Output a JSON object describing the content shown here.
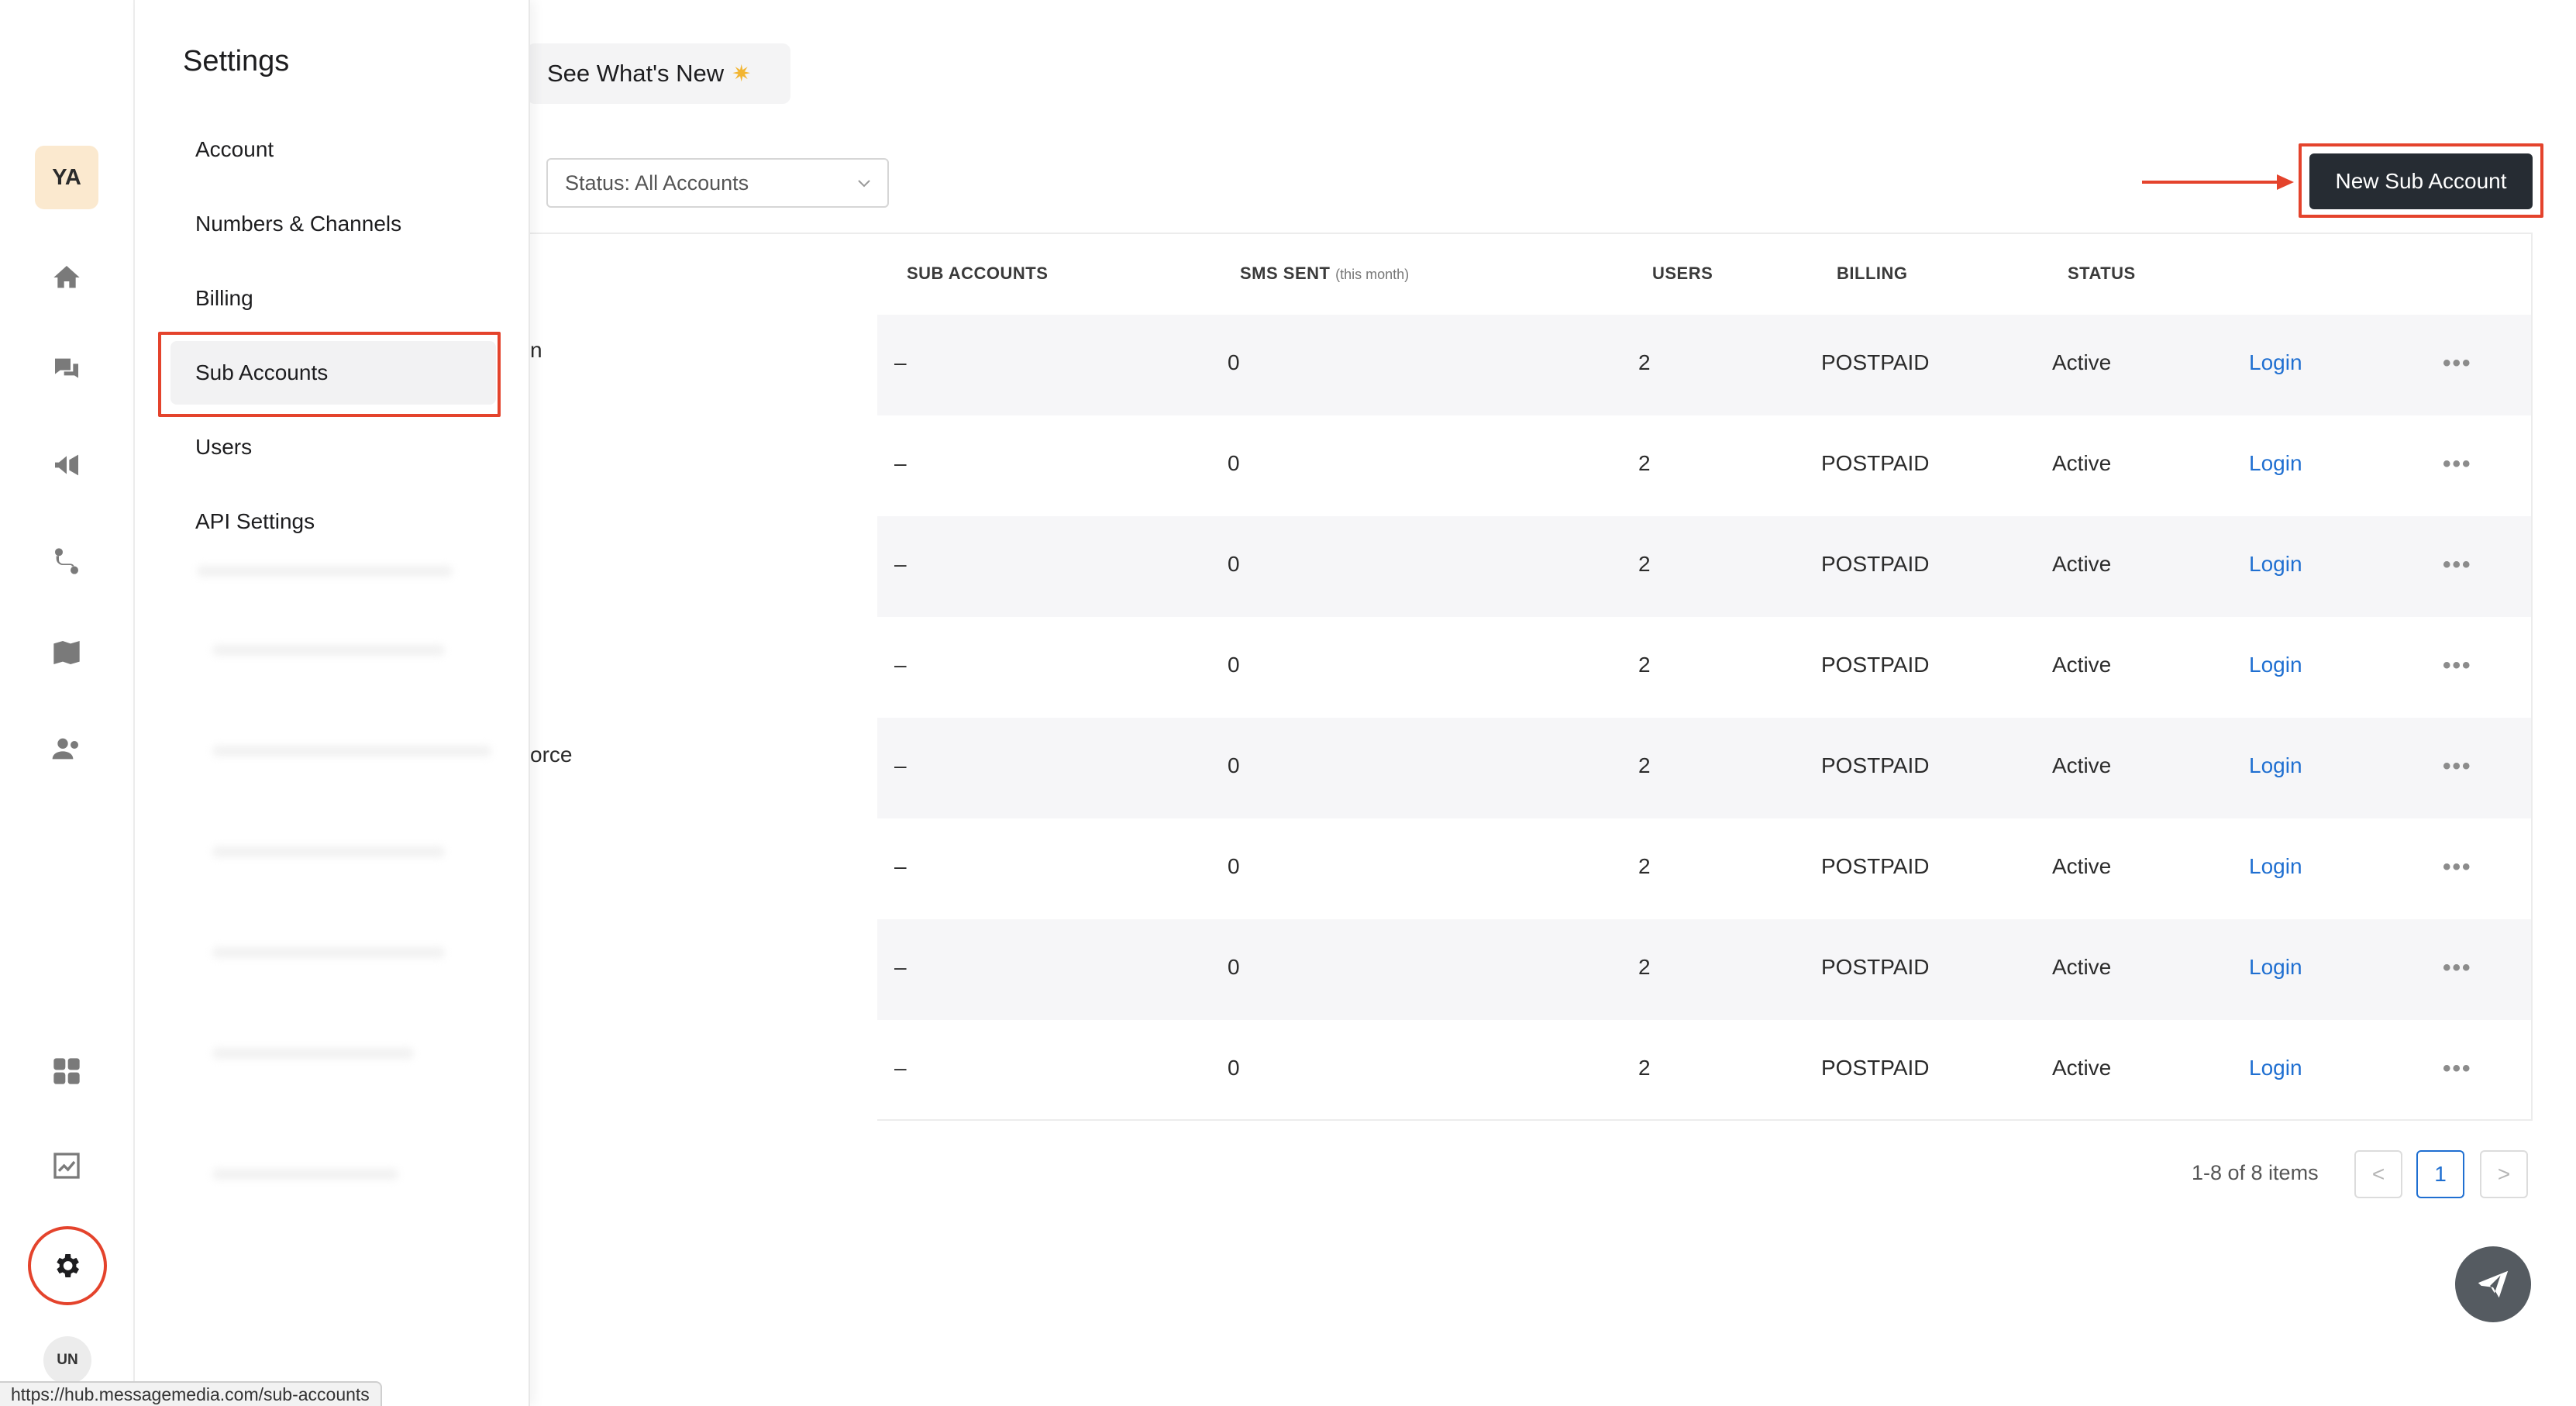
{
  "rail": {
    "avatar_initials": "YA",
    "user_initials": "UN",
    "icons": [
      "home-icon",
      "chat-icon",
      "megaphone-icon",
      "workflow-icon",
      "book-icon",
      "contacts-icon",
      "apps-icon",
      "analytics-icon",
      "gear-icon"
    ]
  },
  "settings": {
    "title": "Settings",
    "items": [
      "Account",
      "Numbers & Channels",
      "Billing",
      "Sub Accounts",
      "Users",
      "API Settings"
    ],
    "selected": "Sub Accounts"
  },
  "header": {
    "whats_new_label": "See What's New",
    "whats_new_icon": "sparkle-icon",
    "status_filter": "Status: All Accounts",
    "new_sub_account_label": "New Sub Account"
  },
  "table": {
    "columns": [
      "SUB ACCOUNTS",
      "SMS SENT",
      "USERS",
      "BILLING",
      "STATUS"
    ],
    "sms_sent_suffix": "(this month)",
    "name_fragments": {
      "row1": "n",
      "row5": "orce"
    },
    "rows": [
      {
        "sub_accounts": "–",
        "sms_sent": "0",
        "users": "2",
        "billing": "POSTPAID",
        "status": "Active",
        "action": "Login"
      },
      {
        "sub_accounts": "–",
        "sms_sent": "0",
        "users": "2",
        "billing": "POSTPAID",
        "status": "Active",
        "action": "Login"
      },
      {
        "sub_accounts": "–",
        "sms_sent": "0",
        "users": "2",
        "billing": "POSTPAID",
        "status": "Active",
        "action": "Login"
      },
      {
        "sub_accounts": "–",
        "sms_sent": "0",
        "users": "2",
        "billing": "POSTPAID",
        "status": "Active",
        "action": "Login"
      },
      {
        "sub_accounts": "–",
        "sms_sent": "0",
        "users": "2",
        "billing": "POSTPAID",
        "status": "Active",
        "action": "Login"
      },
      {
        "sub_accounts": "–",
        "sms_sent": "0",
        "users": "2",
        "billing": "POSTPAID",
        "status": "Active",
        "action": "Login"
      },
      {
        "sub_accounts": "–",
        "sms_sent": "0",
        "users": "2",
        "billing": "POSTPAID",
        "status": "Active",
        "action": "Login"
      },
      {
        "sub_accounts": "–",
        "sms_sent": "0",
        "users": "2",
        "billing": "POSTPAID",
        "status": "Active",
        "action": "Login"
      }
    ],
    "more_label": "•••"
  },
  "pagination": {
    "summary": "1-8 of 8 items",
    "current_page": "1",
    "prev": "<",
    "next": ">"
  },
  "status_bar_url": "https://hub.messagemedia.com/sub-accounts",
  "colors": {
    "annotation_red": "#e4432c",
    "primary_button": "#262c33",
    "link_blue": "#1f6fd1",
    "avatar_bg": "#fbe9cf"
  }
}
